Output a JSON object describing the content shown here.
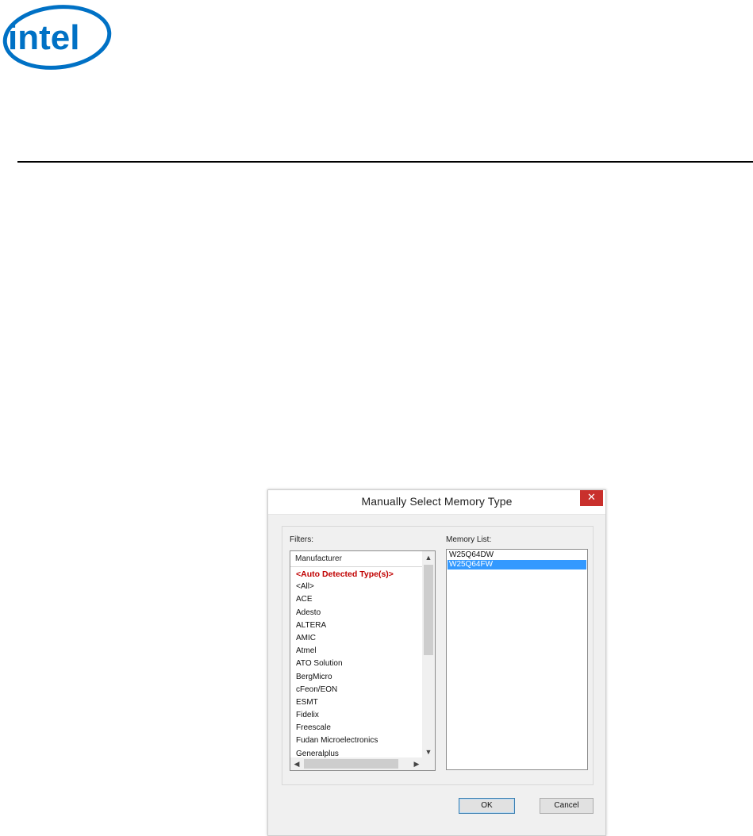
{
  "brand": {
    "logo_text": "intel",
    "logo_color": "#0071c5"
  },
  "dialog": {
    "title": "Manually Select Memory Type",
    "close_icon": "close-icon",
    "filters_label": "Filters:",
    "memory_list_label": "Memory List:",
    "manufacturer_header": "Manufacturer",
    "manufacturers": [
      "<Auto Detected Type(s)>",
      "<All>",
      "ACE",
      "Adesto",
      "ALTERA",
      "AMIC",
      "Atmel",
      "ATO Solution",
      "BergMicro",
      "cFeon/EON",
      "ESMT",
      "Fidelix",
      "Freescale",
      "Fudan Microelectronics",
      "Generalplus"
    ],
    "memory_items": [
      "W25Q64DW",
      "W25Q64FW"
    ],
    "selected_memory": "W25Q64FW",
    "ok_label": "OK",
    "cancel_label": "Cancel",
    "colors": {
      "special_item": "#c00000",
      "selection": "#3399ff",
      "close_button": "#c9302c"
    }
  }
}
